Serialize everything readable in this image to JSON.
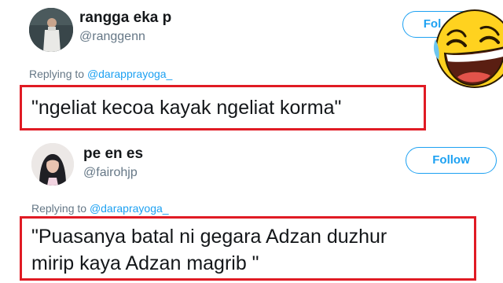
{
  "tweets": [
    {
      "display_name": "rangga eka p",
      "handle": "@ranggenn",
      "follow_label": "Fol",
      "replying_prefix": "Replying to ",
      "replying_mention": "@darapprayoga_",
      "quote": "\"ngeliat kecoa kayak ngeliat korma\""
    },
    {
      "display_name": "pe en es",
      "handle": "@fairohjp",
      "follow_label": "Follow",
      "replying_prefix": "Replying to ",
      "replying_mention": "@daraprayoga_",
      "quote_lines": [
        "\"Puasanya batal ni gegara Adzan duzhur",
        "mirip kaya Adzan magrib \""
      ]
    }
  ],
  "colors": {
    "accent": "#1da1f2",
    "highlight_border": "#e01b24",
    "muted_text": "#657786",
    "emoji_face": "#ffd21f"
  },
  "icons": {
    "overlay": "laughing-emoji-icon"
  }
}
